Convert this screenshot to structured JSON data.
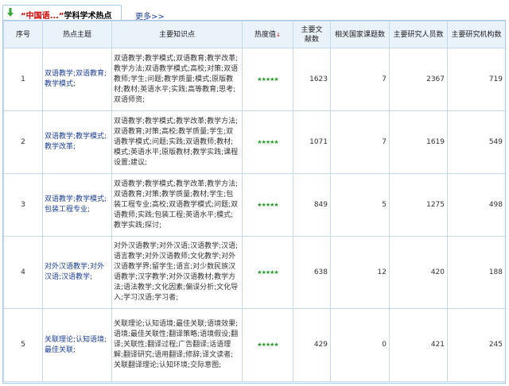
{
  "tab": {
    "query": "“中国语...”",
    "label": "学科学术热点",
    "icon": "download-arrow-icon",
    "icon_color": "#3aa63a"
  },
  "more_link": "更多>>",
  "columns": {
    "seq": "序号",
    "topic": "热点主题",
    "knowledge": "主要知识点",
    "heat": "热度值",
    "heat_sort": "↓",
    "docs": "主要文献数",
    "projects": "相关国家课题数",
    "researchers": "主要研究人员数",
    "institutions": "主要研究机构数"
  },
  "rows": [
    {
      "seq": "1",
      "topic": "双语教学;双语教育;教学模式;",
      "knowledge": "双语教学;教学模式;双语教育;教学改革;教学方法;双语教学模式;高校;对策;双语教师;学生;问题;教学质量;模式;原版教材;教材;英语水平;实践;高等教育;思考;双语师资;",
      "heat": "★★★★★",
      "docs": "1623",
      "projects": "7",
      "researchers": "2367",
      "institutions": "719"
    },
    {
      "seq": "2",
      "topic": "双语教学;教学模式;教学改革;",
      "knowledge": "双语教学;教学模式;教学改革;教学方法;双语教育;对策;高校;教学质量;学生;双语教学模式;问题;实践;双语教师;教材;模式;英语水平;原版教材;教学实践;课程设置;建议;",
      "heat": "★★★★★",
      "docs": "1071",
      "projects": "7",
      "researchers": "1619",
      "institutions": "549"
    },
    {
      "seq": "3",
      "topic": "双语教学;教学模式;包装工程专业;",
      "knowledge": "双语教学;教学模式;教学改革;教学方法;双语教育;对策;教学质量;教材;学生;包装工程专业;高校;双语教学模式;问题;双语教师;实践;包装工程;英语水平;模式;教学实践;探讨;",
      "heat": "★★★★★",
      "docs": "849",
      "projects": "5",
      "researchers": "1275",
      "institutions": "498"
    },
    {
      "seq": "4",
      "topic": "对外汉语教学;对外汉语;汉语教学;",
      "knowledge": "对外汉语教学;对外汉语;汉语教学;汉语;语言教学;对外汉语教师;文化教学;对外汉语教学界;留学生;语言;对少数民族汉语教学;汉字教学;对外汉语教材;教学方法;语法教学;文化因素;偏误分析;文化导入;学习汉语;学习者;",
      "heat": "★★★★★",
      "docs": "638",
      "projects": "12",
      "researchers": "420",
      "institutions": "188"
    },
    {
      "seq": "5",
      "topic": "关联理论;认知语境;最佳关联;",
      "knowledge": "关联理论;认知语境;最佳关联;语境效果;语境;最佳关联性;翻译策略;语境假设;翻译;关联性;翻译过程;广告翻译;话语理解;翻译研究;语用翻译;修辞;译文读者;关联翻译理论;认知环境;交际意图;",
      "heat": "★★★★★",
      "docs": "429",
      "projects": "0",
      "researchers": "421",
      "institutions": "245"
    }
  ]
}
